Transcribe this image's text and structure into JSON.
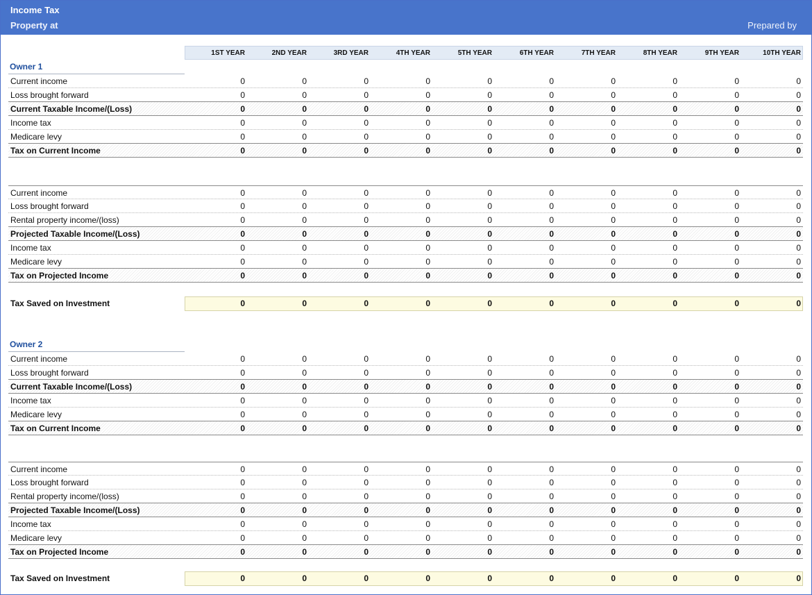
{
  "header": {
    "title": "Income Tax",
    "subtitle": "Property at",
    "prepared_by": "Prepared by"
  },
  "years": [
    "1ST YEAR",
    "2ND YEAR",
    "3RD YEAR",
    "4TH YEAR",
    "5TH YEAR",
    "6TH YEAR",
    "7TH YEAR",
    "8TH YEAR",
    "9TH YEAR",
    "10TH YEAR"
  ],
  "owners": [
    {
      "name": "Owner 1",
      "current": [
        {
          "label": "Current income",
          "values": [
            0,
            0,
            0,
            0,
            0,
            0,
            0,
            0,
            0,
            0
          ]
        },
        {
          "label": "Loss brought forward",
          "values": [
            0,
            0,
            0,
            0,
            0,
            0,
            0,
            0,
            0,
            0
          ]
        },
        {
          "label": "Current Taxable Income/(Loss)",
          "values": [
            0,
            0,
            0,
            0,
            0,
            0,
            0,
            0,
            0,
            0
          ]
        },
        {
          "label": "Income tax",
          "values": [
            0,
            0,
            0,
            0,
            0,
            0,
            0,
            0,
            0,
            0
          ]
        },
        {
          "label": "Medicare levy",
          "values": [
            0,
            0,
            0,
            0,
            0,
            0,
            0,
            0,
            0,
            0
          ]
        },
        {
          "label": "Tax on Current Income",
          "values": [
            0,
            0,
            0,
            0,
            0,
            0,
            0,
            0,
            0,
            0
          ]
        }
      ],
      "projected": [
        {
          "label": "Current income",
          "values": [
            0,
            0,
            0,
            0,
            0,
            0,
            0,
            0,
            0,
            0
          ]
        },
        {
          "label": "Loss brought forward",
          "values": [
            0,
            0,
            0,
            0,
            0,
            0,
            0,
            0,
            0,
            0
          ]
        },
        {
          "label": "Rental property income/(loss)",
          "values": [
            0,
            0,
            0,
            0,
            0,
            0,
            0,
            0,
            0,
            0
          ]
        },
        {
          "label": "Projected Taxable Income/(Loss)",
          "values": [
            0,
            0,
            0,
            0,
            0,
            0,
            0,
            0,
            0,
            0
          ]
        },
        {
          "label": "Income tax",
          "values": [
            0,
            0,
            0,
            0,
            0,
            0,
            0,
            0,
            0,
            0
          ]
        },
        {
          "label": "Medicare levy",
          "values": [
            0,
            0,
            0,
            0,
            0,
            0,
            0,
            0,
            0,
            0
          ]
        },
        {
          "label": "Tax on Projected Income",
          "values": [
            0,
            0,
            0,
            0,
            0,
            0,
            0,
            0,
            0,
            0
          ]
        }
      ],
      "tax_saved": {
        "label": "Tax Saved on Investment",
        "values": [
          0,
          0,
          0,
          0,
          0,
          0,
          0,
          0,
          0,
          0
        ]
      }
    },
    {
      "name": "Owner 2",
      "current": [
        {
          "label": "Current income",
          "values": [
            0,
            0,
            0,
            0,
            0,
            0,
            0,
            0,
            0,
            0
          ]
        },
        {
          "label": "Loss brought forward",
          "values": [
            0,
            0,
            0,
            0,
            0,
            0,
            0,
            0,
            0,
            0
          ]
        },
        {
          "label": "Current Taxable Income/(Loss)",
          "values": [
            0,
            0,
            0,
            0,
            0,
            0,
            0,
            0,
            0,
            0
          ]
        },
        {
          "label": "Income tax",
          "values": [
            0,
            0,
            0,
            0,
            0,
            0,
            0,
            0,
            0,
            0
          ]
        },
        {
          "label": "Medicare levy",
          "values": [
            0,
            0,
            0,
            0,
            0,
            0,
            0,
            0,
            0,
            0
          ]
        },
        {
          "label": "Tax on Current Income",
          "values": [
            0,
            0,
            0,
            0,
            0,
            0,
            0,
            0,
            0,
            0
          ]
        }
      ],
      "projected": [
        {
          "label": "Current income",
          "values": [
            0,
            0,
            0,
            0,
            0,
            0,
            0,
            0,
            0,
            0
          ]
        },
        {
          "label": "Loss brought forward",
          "values": [
            0,
            0,
            0,
            0,
            0,
            0,
            0,
            0,
            0,
            0
          ]
        },
        {
          "label": "Rental property income/(loss)",
          "values": [
            0,
            0,
            0,
            0,
            0,
            0,
            0,
            0,
            0,
            0
          ]
        },
        {
          "label": "Projected Taxable Income/(Loss)",
          "values": [
            0,
            0,
            0,
            0,
            0,
            0,
            0,
            0,
            0,
            0
          ]
        },
        {
          "label": "Income tax",
          "values": [
            0,
            0,
            0,
            0,
            0,
            0,
            0,
            0,
            0,
            0
          ]
        },
        {
          "label": "Medicare levy",
          "values": [
            0,
            0,
            0,
            0,
            0,
            0,
            0,
            0,
            0,
            0
          ]
        },
        {
          "label": "Tax on Projected Income",
          "values": [
            0,
            0,
            0,
            0,
            0,
            0,
            0,
            0,
            0,
            0
          ]
        }
      ],
      "tax_saved": {
        "label": "Tax Saved on Investment",
        "values": [
          0,
          0,
          0,
          0,
          0,
          0,
          0,
          0,
          0,
          0
        ]
      }
    }
  ]
}
